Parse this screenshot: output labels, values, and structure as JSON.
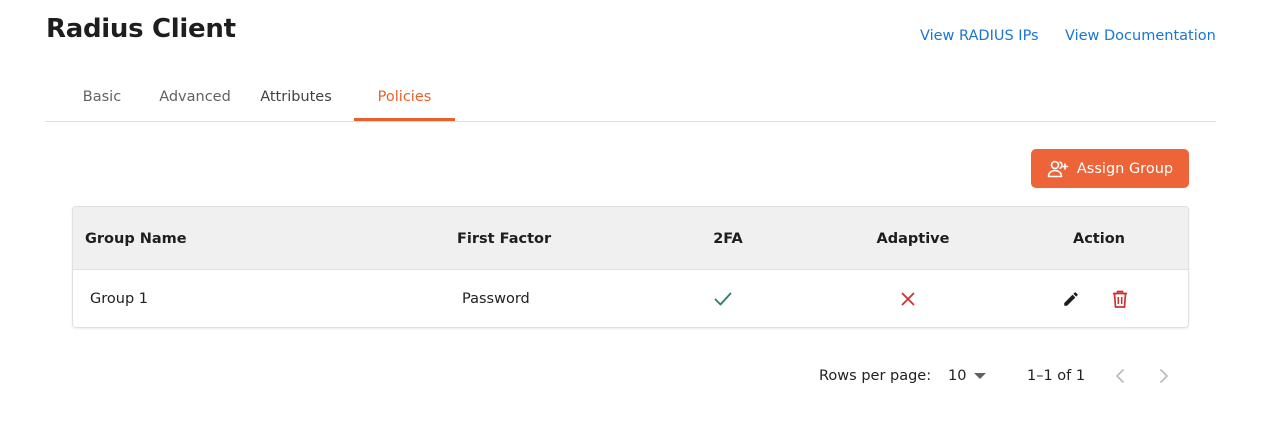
{
  "header": {
    "title": "Radius Client",
    "links": {
      "view_ips": "View RADIUS IPs",
      "view_docs": "View Documentation"
    }
  },
  "tabs": [
    {
      "label": "Basic"
    },
    {
      "label": "Advanced"
    },
    {
      "label": "Attributes"
    },
    {
      "label": "Policies",
      "active": true
    }
  ],
  "actions": {
    "assign_group": "Assign Group",
    "icon": "add-user-icon"
  },
  "table": {
    "columns": [
      "Group Name",
      "First Factor",
      "2FA",
      "Adaptive",
      "Action"
    ],
    "rows": [
      {
        "group_name": "Group 1",
        "first_factor": "Password",
        "two_fa": "check",
        "adaptive": "cross",
        "actions": [
          "edit-icon",
          "delete-icon"
        ]
      }
    ]
  },
  "pagination": {
    "rows_per_page_label": "Rows per page:",
    "rows_per_page": "10",
    "range": "1–1 of 1"
  },
  "colors": {
    "accent": "#ec6437",
    "link": "#1976d2",
    "check": "#2e7d5b",
    "cross": "#d32f2f",
    "delete": "#d32f2f"
  }
}
